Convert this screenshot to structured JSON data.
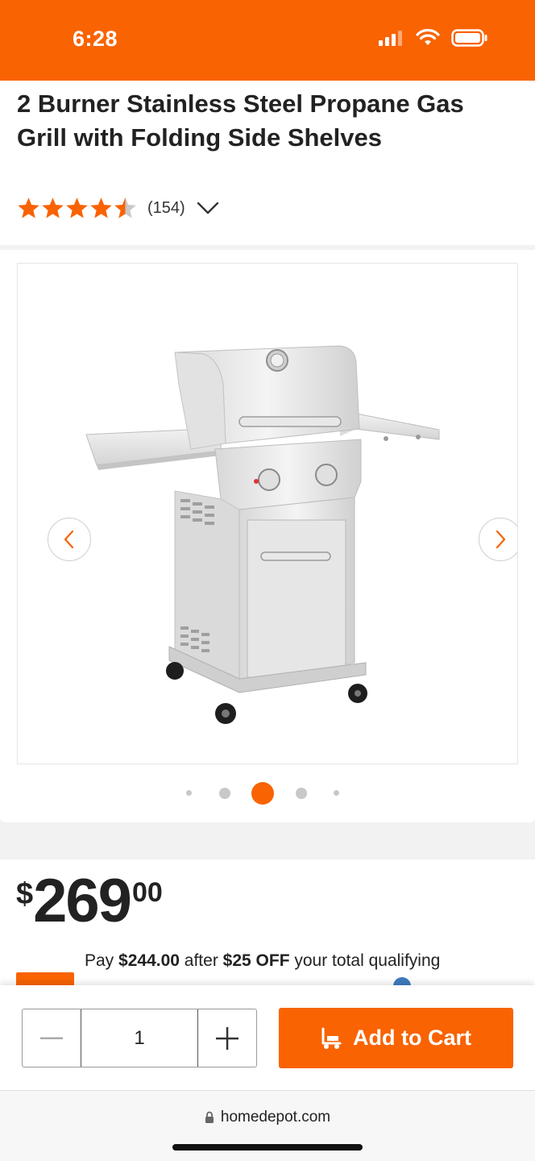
{
  "status_bar": {
    "time": "6:28"
  },
  "product": {
    "title": "2 Burner Stainless Steel Propane Gas Grill with Folding Side Shelves",
    "rating": 4.5,
    "review_count": "(154)"
  },
  "gallery": {
    "image_count": 5,
    "active_index": 2,
    "prev_label": "previous image",
    "next_label": "next image"
  },
  "price": {
    "symbol": "$",
    "dollars": "269",
    "cents": "00"
  },
  "promo": {
    "pay_prefix": "Pay ",
    "pay_amount": "$244.00",
    "after_text": " after ",
    "discount": "$25 OFF",
    "suffix": " your total qualifying"
  },
  "cart": {
    "quantity": "1",
    "add_to_cart_label": "Add to Cart"
  },
  "browser": {
    "url": "homedepot.com"
  },
  "colors": {
    "brand": "#f96302",
    "text": "#222222"
  }
}
